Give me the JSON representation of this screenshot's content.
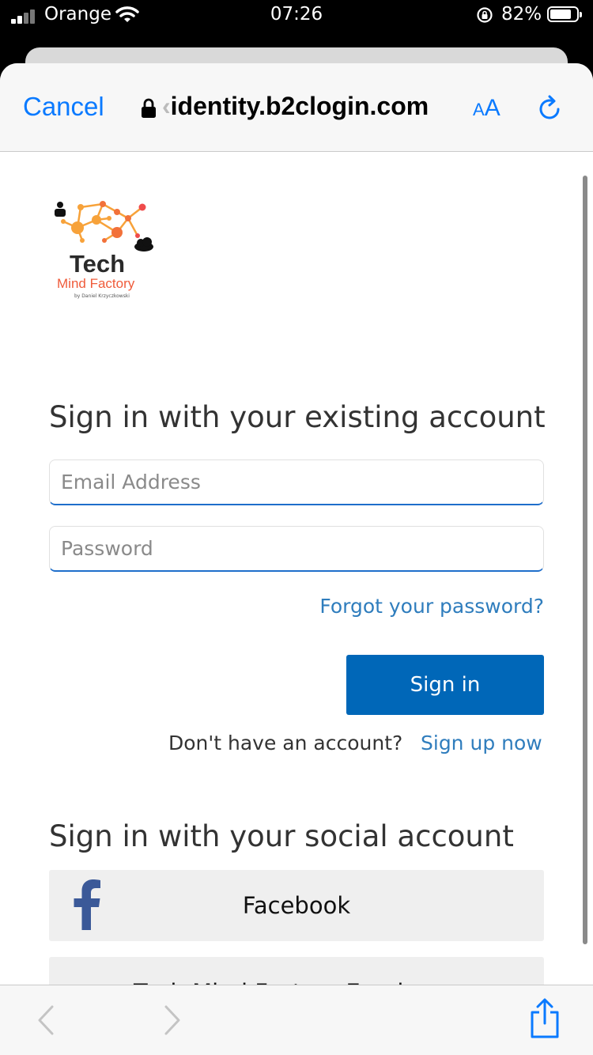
{
  "status_bar": {
    "carrier": "Orange",
    "time": "07:26",
    "battery_percent": "82%",
    "battery_level": 0.82
  },
  "browser": {
    "cancel_label": "Cancel",
    "url_faded": "‹",
    "url": "identity.b2clogin.com",
    "text_size_small": "A",
    "text_size_big": "A"
  },
  "logo": {
    "word1": "Tech",
    "word2": "Mind Factory",
    "byline": "by Daniel Krzyczkowski"
  },
  "local_signin": {
    "heading": "Sign in with your existing account",
    "email_placeholder": "Email Address",
    "password_placeholder": "Password",
    "forgot_link": "Forgot your password?",
    "signin_button": "Sign in",
    "no_account_text": "Don't have an account?",
    "signup_link": "Sign up now"
  },
  "social_signin": {
    "heading": "Sign in with your social account",
    "buttons": [
      {
        "label": "Facebook",
        "icon": "facebook-icon"
      },
      {
        "label": "Tech Mind Factory Employee"
      }
    ]
  },
  "colors": {
    "ios_blue": "#0a7aff",
    "primary_button": "#0067b8",
    "link": "#2f7dbd",
    "facebook": "#3b5998",
    "logo_orange": "#f7a23a"
  }
}
